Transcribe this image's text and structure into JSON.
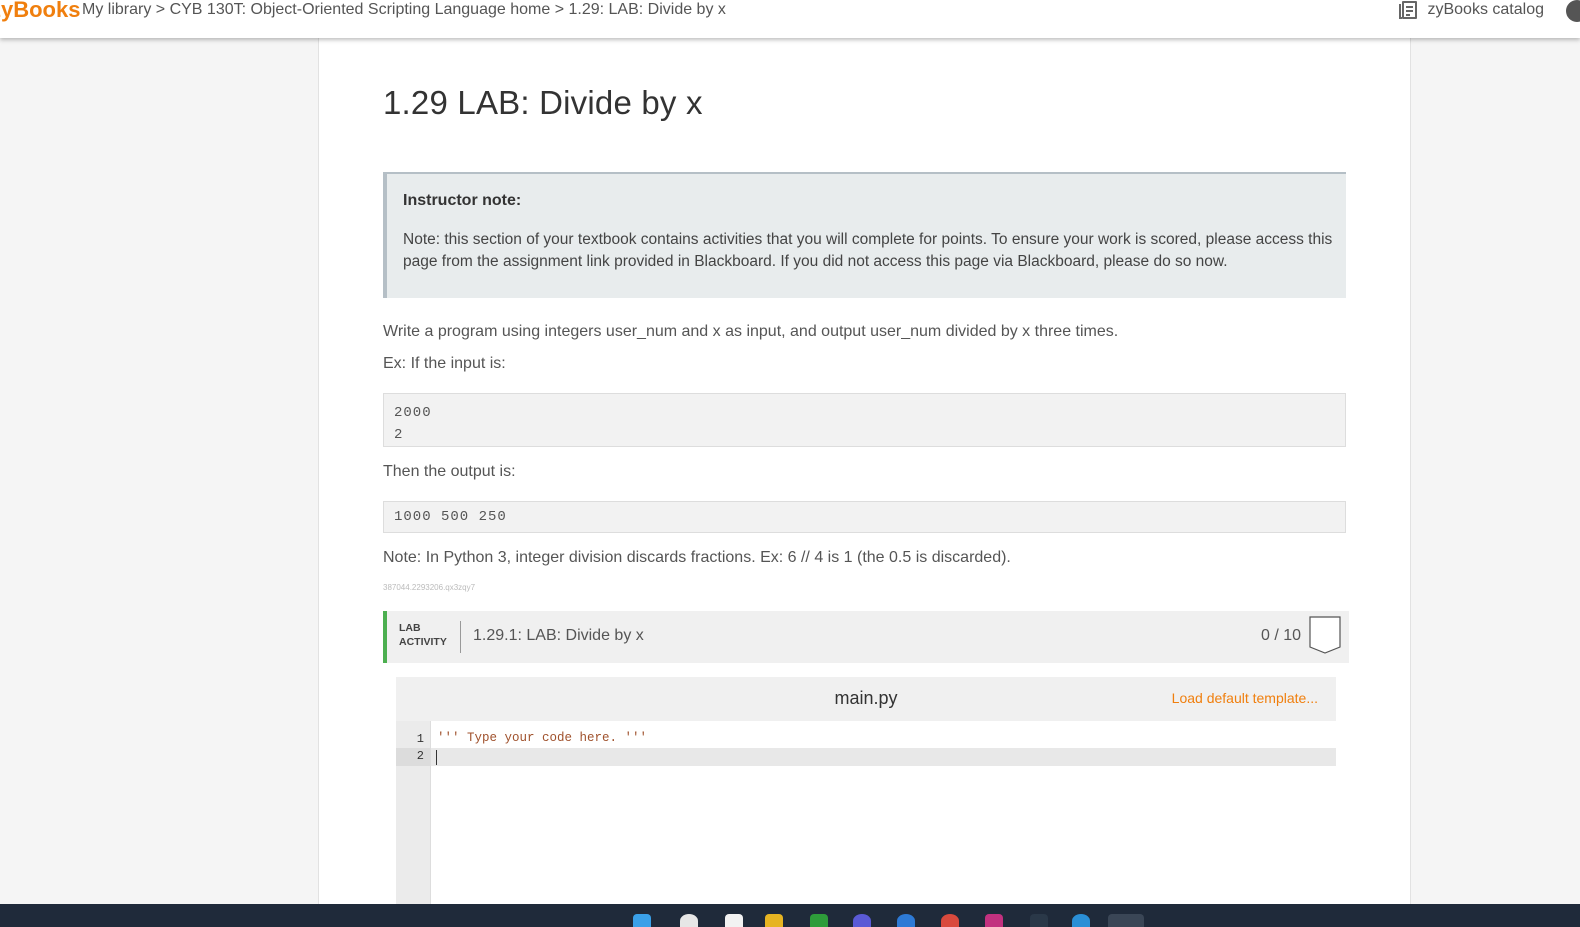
{
  "header": {
    "logo": "zyBooks",
    "breadcrumb": {
      "library": "My library",
      "sep1": " > ",
      "course": "CYB 130T: Object-Oriented Scripting Language home",
      "sep2": " > ",
      "section": "1.29: LAB: Divide by x"
    },
    "catalog_label": "zyBooks catalog"
  },
  "page": {
    "title": "1.29 LAB: Divide by x",
    "instructor_note": {
      "heading": "Instructor note:",
      "body": "Note: this section of your textbook contains activities that you will complete for points. To ensure your work is scored, please access this page from the assignment link provided in Blackboard. If you did not access this page via Blackboard, please do so now."
    },
    "intro": "Write a program using integers user_num and x as input, and output user_num divided by x three times.",
    "input_label": "Ex: If the input is:",
    "input_example": [
      "2000",
      "2"
    ],
    "output_label": "Then the output is:",
    "output_example": "1000 500 250",
    "python_note": "Note: In Python 3, integer division discards fractions. Ex: 6 // 4 is 1 (the 0.5 is discarded).",
    "activity_id": "387044.2293206.qx3zqy7"
  },
  "lab": {
    "tag_line1": "LAB",
    "tag_line2": "ACTIVITY",
    "name": "1.29.1: LAB: Divide by x",
    "score": "0 / 10",
    "accent": "#4caf50"
  },
  "editor": {
    "filename": "main.py",
    "load_template": "Load default template...",
    "line_numbers": [
      "1",
      "2"
    ],
    "lines": [
      "''' Type your code here. '''",
      ""
    ]
  },
  "colors": {
    "brand": "#f07f0e",
    "taskbar": "#1f2a3a"
  }
}
